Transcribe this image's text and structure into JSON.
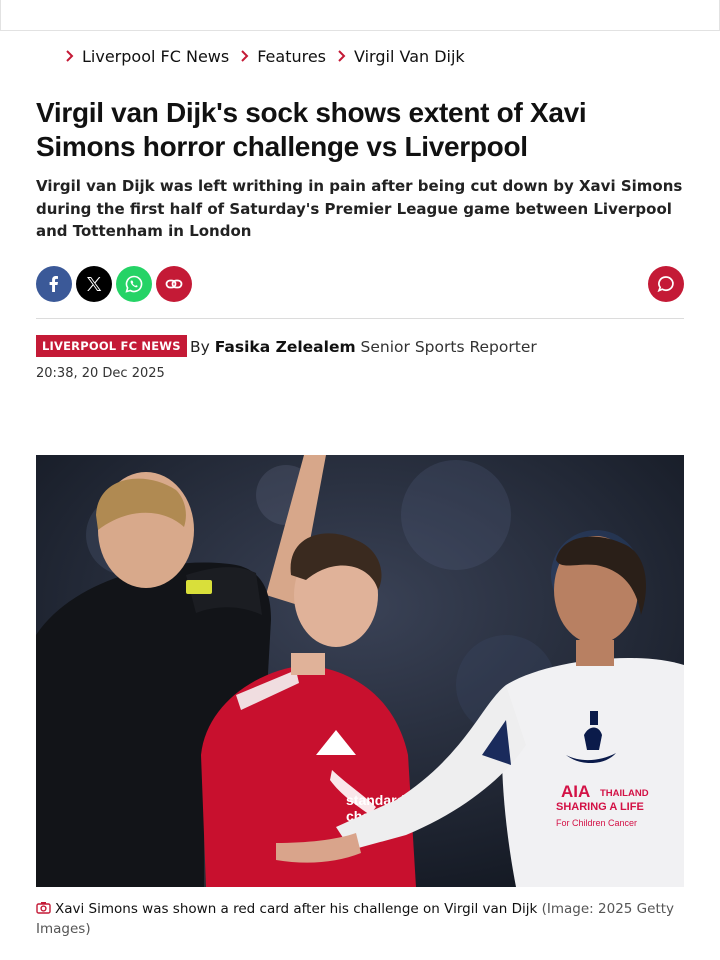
{
  "breadcrumb": [
    "Liverpool FC News",
    "Features",
    "Virgil Van Dijk"
  ],
  "article": {
    "headline": "Virgil van Dijk's sock shows extent of Xavi Simons horror challenge vs Liverpool",
    "standfirst": "Virgil van Dijk was left writhing in pain after being cut down by Xavi Simons during the first half of Saturday's Premier League game between Liverpool and Tottenham in London",
    "tag": "LIVERPOOL FC NEWS",
    "by": "By",
    "author": "Fasika Zelealem",
    "role": "Senior Sports Reporter",
    "timestamp": "20:38, 20 Dec 2025"
  },
  "share": {
    "icons": [
      "facebook-icon",
      "x-icon",
      "whatsapp-icon",
      "link-icon",
      "comment-icon"
    ]
  },
  "image": {
    "shirt_text": [
      "AIA",
      "THAILAND",
      "SHARING A LIFE",
      "For Children Cancer"
    ],
    "sponsor_text": [
      "standard",
      "chart"
    ],
    "caption": "Xavi Simons was shown a red card after his challenge on Virgil van Dijk",
    "credit": "(Image: 2025 Getty Images)"
  },
  "colors": {
    "accent": "#c41a36",
    "facebook": "#3b5998",
    "whatsapp": "#25d366"
  }
}
